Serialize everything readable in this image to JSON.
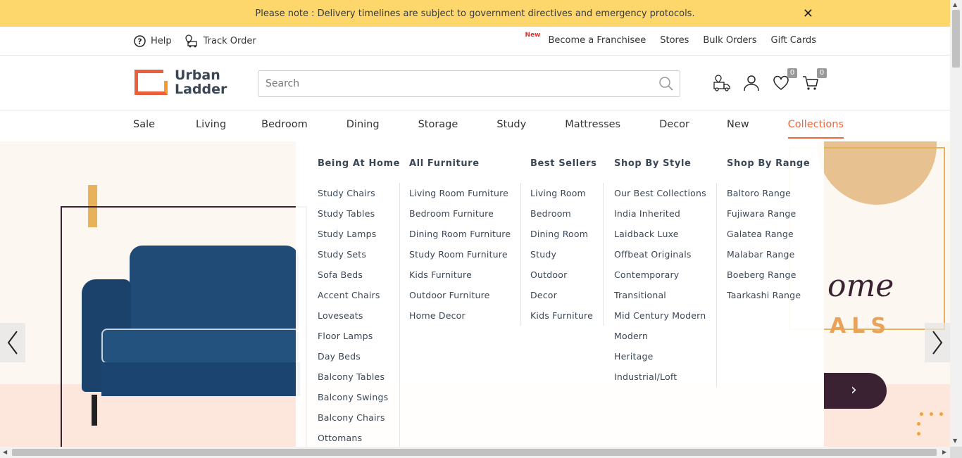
{
  "notice": {
    "text": "Please note : Delivery timelines are subject to government directives and emergency protocols.",
    "close": "✕"
  },
  "utility": {
    "help": "Help",
    "track_order": "Track Order",
    "new_tag": "New",
    "franchisee": "Become a Franchisee",
    "stores": "Stores",
    "bulk_orders": "Bulk Orders",
    "gift_cards": "Gift Cards"
  },
  "logo": {
    "line1": "Urban",
    "line2": "Ladder"
  },
  "search": {
    "placeholder": "Search"
  },
  "header_icons": {
    "wishlist_count": "0",
    "cart_count": "0"
  },
  "nav": {
    "items": [
      "Sale",
      "Living",
      "Bedroom",
      "Dining",
      "Storage",
      "Study",
      "Mattresses",
      "Decor",
      "New",
      "Collections"
    ],
    "active": "Collections"
  },
  "mega_menu": {
    "columns": [
      {
        "heading": "Being At Home",
        "links": [
          "Study Chairs",
          "Study Tables",
          "Study Lamps",
          "Study Sets",
          "Sofa Beds",
          "Accent Chairs",
          "Loveseats",
          "Floor Lamps",
          "Day Beds",
          "Balcony Tables",
          "Balcony Swings",
          "Balcony Chairs",
          "Ottomans"
        ]
      },
      {
        "heading": "All Furniture",
        "links": [
          "Living Room Furniture",
          "Bedroom Furniture",
          "Dining Room Furniture",
          "Study Room Furniture",
          "Kids Furniture",
          "Outdoor Furniture",
          "Home Decor"
        ]
      },
      {
        "heading": "Best Sellers",
        "links": [
          "Living Room",
          "Bedroom",
          "Dining Room",
          "Study",
          "Outdoor",
          "Decor",
          "Kids Furniture"
        ]
      },
      {
        "heading": "Shop By Style",
        "links": [
          "Our Best Collections",
          "India Inherited",
          "Laidback Luxe",
          "Offbeat Originals",
          "Contemporary",
          "Transitional",
          "Mid Century Modern",
          "Modern",
          "Heritage",
          "Industrial/Loft"
        ]
      },
      {
        "heading": "Shop By Range",
        "links": [
          "Baltoro Range",
          "Fujiwara Range",
          "Galatea Range",
          "Malabar Range",
          "Boeberg Range",
          "Taarkashi Range"
        ]
      }
    ]
  },
  "hero": {
    "script_text": "ome",
    "sub_text": "ALS"
  },
  "colors": {
    "notice_bg": "#fdd76b",
    "accent": "#f1673a",
    "text": "#3b4755"
  }
}
